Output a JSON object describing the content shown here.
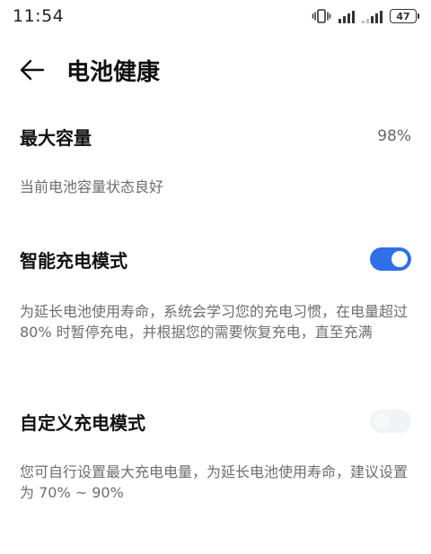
{
  "status_bar": {
    "time": "11:54",
    "battery_level": "47"
  },
  "header": {
    "title": "电池健康"
  },
  "max_capacity": {
    "label": "最大容量",
    "value": "98%",
    "description": "当前电池容量状态良好"
  },
  "smart_charging": {
    "label": "智能充电模式",
    "enabled": true,
    "description": "为延长电池使用寿命，系统会学习您的充电习惯，在电量超过 80% 时暂停充电，并根据您的需要恢复充电，直至充满"
  },
  "custom_charging": {
    "label": "自定义充电模式",
    "enabled": false,
    "description": "您可自行设置最大充电电量，为延长电池使用寿命，建议设置为 70% ~ 90%"
  },
  "colors": {
    "accent": "#2f6fe8",
    "secondary_text": "#6e6e6e"
  }
}
